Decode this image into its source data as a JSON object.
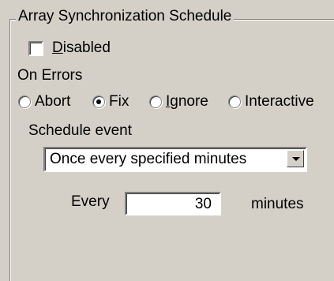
{
  "group": {
    "title": "Array Synchronization Schedule"
  },
  "disabled": {
    "label_prefix": "",
    "label_accel": "D",
    "label_rest": "isabled",
    "checked": false
  },
  "on_errors": {
    "label": "On Errors",
    "options": [
      {
        "label": "Abort",
        "selected": false
      },
      {
        "label": "Fix",
        "selected": true
      },
      {
        "label_prefix": "",
        "label_accel": "I",
        "label_rest": "gnore",
        "selected": false
      },
      {
        "label": "Interactive",
        "selected": false
      }
    ]
  },
  "schedule_event": {
    "label": "Schedule event",
    "selected": "Once every specified minutes"
  },
  "interval": {
    "every_label": "Every",
    "value": "30",
    "unit_label": "minutes"
  }
}
